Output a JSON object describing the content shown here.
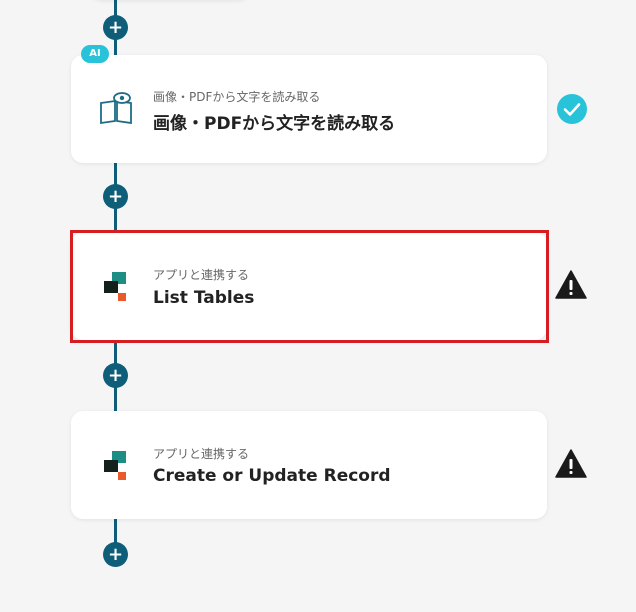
{
  "steps": [
    {
      "badge": "AI",
      "subtitle": "画像・PDFから文字を読み取る",
      "title": "画像・PDFから文字を読み取る",
      "status": "check"
    },
    {
      "subtitle": "アプリと連携する",
      "title": "List Tables",
      "status": "warning"
    },
    {
      "subtitle": "アプリと連携する",
      "title": "Create or Update Record",
      "status": "warning"
    }
  ],
  "add_step_symbol": "+",
  "colors": {
    "connector": "#0e5e79",
    "highlight": "#d61e22",
    "check": "#28c3d9",
    "warning": "#1a1a1a"
  }
}
